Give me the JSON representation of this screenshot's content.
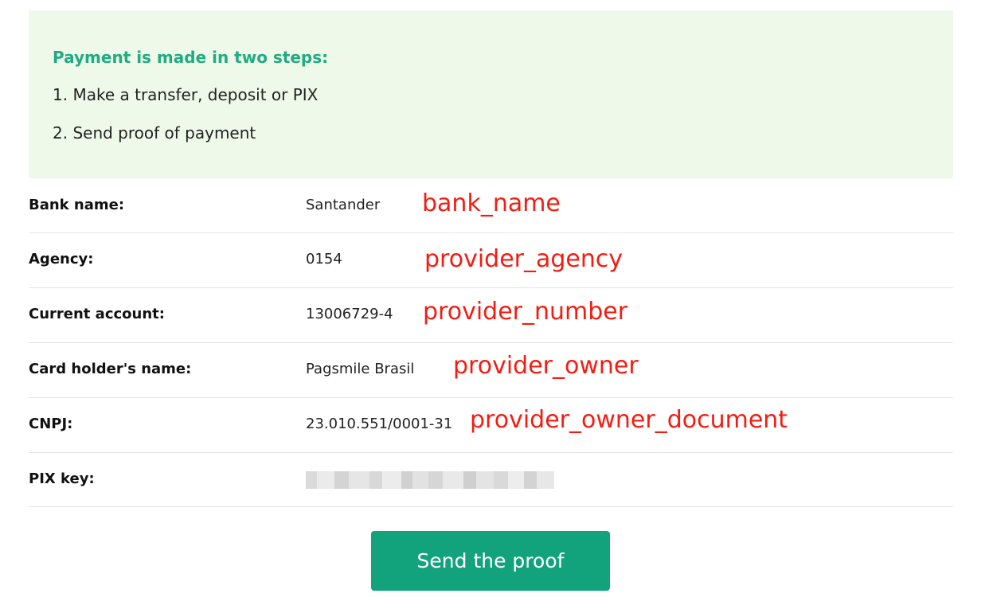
{
  "info": {
    "title": "Payment is made in two steps:",
    "step1": "1. Make a transfer, deposit or PIX",
    "step2": "2. Send proof of payment"
  },
  "details": [
    {
      "label": "Bank name:",
      "value": "Santander",
      "annotation": "bank_name"
    },
    {
      "label": "Agency:",
      "value": "0154",
      "annotation": "provider_agency"
    },
    {
      "label": "Current account:",
      "value": "13006729-4",
      "annotation": "provider_number"
    },
    {
      "label": "Card holder's name:",
      "value": "Pagsmile Brasil",
      "annotation": "provider_owner"
    },
    {
      "label": "CNPJ:",
      "value": "23.010.551/0001-31",
      "annotation": "provider_owner_document"
    },
    {
      "label": "PIX key:"
    }
  ],
  "button": {
    "label": "Send the proof"
  },
  "colors": {
    "info_background": "#eef9e9",
    "info_title": "#22ab83",
    "button": "#13a37c",
    "annotation": "#f21d12"
  }
}
